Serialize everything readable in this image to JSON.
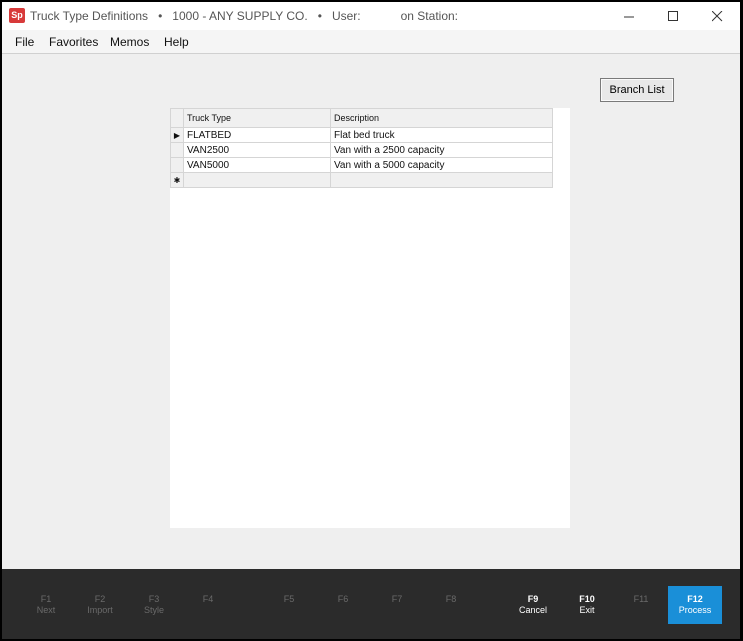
{
  "titlebar": {
    "app_icon": "Sp",
    "title": "Truck Type Definitions",
    "sep1": "•",
    "company": "1000 - ANY SUPPLY CO.",
    "sep2": "•",
    "user_label": "User:",
    "station_label": "on Station:"
  },
  "menu": {
    "file": "File",
    "favorites": "Favorites",
    "memos": "Memos",
    "help": "Help"
  },
  "branch_list_label": "Branch List",
  "grid": {
    "headers": [
      "Truck Type",
      "Description"
    ],
    "rows": [
      {
        "type": "FLATBED",
        "desc": "Flat bed truck"
      },
      {
        "type": "VAN2500",
        "desc": "Van with a 2500 capacity"
      },
      {
        "type": "VAN5000",
        "desc": "Van with a 5000 capacity"
      }
    ],
    "current_row_marker": "▶",
    "new_row_marker": "✱"
  },
  "fkeys": [
    {
      "key": "F1",
      "label": "Next"
    },
    {
      "key": "F2",
      "label": "Import"
    },
    {
      "key": "F3",
      "label": "Style"
    },
    {
      "key": "F4",
      "label": ""
    },
    {
      "key": "F5",
      "label": ""
    },
    {
      "key": "F6",
      "label": ""
    },
    {
      "key": "F7",
      "label": ""
    },
    {
      "key": "F8",
      "label": ""
    },
    {
      "key": "F9",
      "label": "Cancel"
    },
    {
      "key": "F10",
      "label": "Exit"
    },
    {
      "key": "F11",
      "label": ""
    },
    {
      "key": "F12",
      "label": "Process"
    }
  ],
  "colors": {
    "accent": "#1a8fd8",
    "footer_bg": "#2b2b2b",
    "app_icon": "#d83a3a"
  }
}
